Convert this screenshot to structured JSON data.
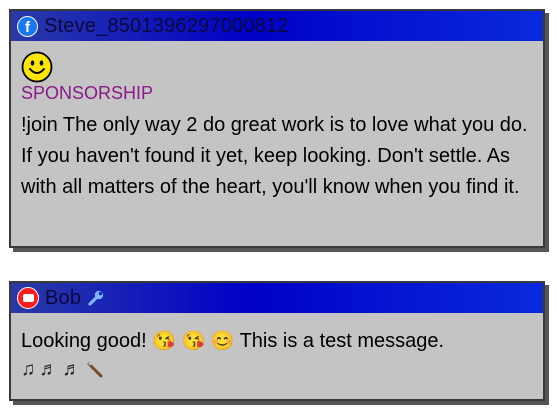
{
  "messages": [
    {
      "platform_icon": "facebook-icon",
      "username": "Steve_8501396297000812",
      "avatar_icon": "smiley-face-icon",
      "badge": "SPONSORSHIP",
      "text": "!join The only way 2 do great work is to love what you do. If you haven't found it yet, keep looking. Don't settle. As with all matters of the heart, you'll know when you find it."
    },
    {
      "platform_icon": "youtube-icon",
      "username": "Bob",
      "role_icon": "wrench-icon",
      "text_parts": {
        "before_emotes": "Looking good!",
        "after_emotes": "This is a test message."
      },
      "emotes_line1": [
        "face-blowing-kiss-emoji",
        "face-blowing-kiss-emoji",
        "smiling-face-emoji"
      ],
      "emotes_line2": [
        "musical-notes-emoji",
        "musical-note-emoji",
        "musical-note-emoji",
        "pick-emoji"
      ]
    }
  ],
  "colors": {
    "header_gradient_start": "#2a3aa8",
    "header_gradient_end": "#0a2adc",
    "card_background": "#c4c4c4",
    "badge_color": "#8a1a8a",
    "facebook_blue": "#1877f2",
    "youtube_red": "#ff1c1c"
  }
}
